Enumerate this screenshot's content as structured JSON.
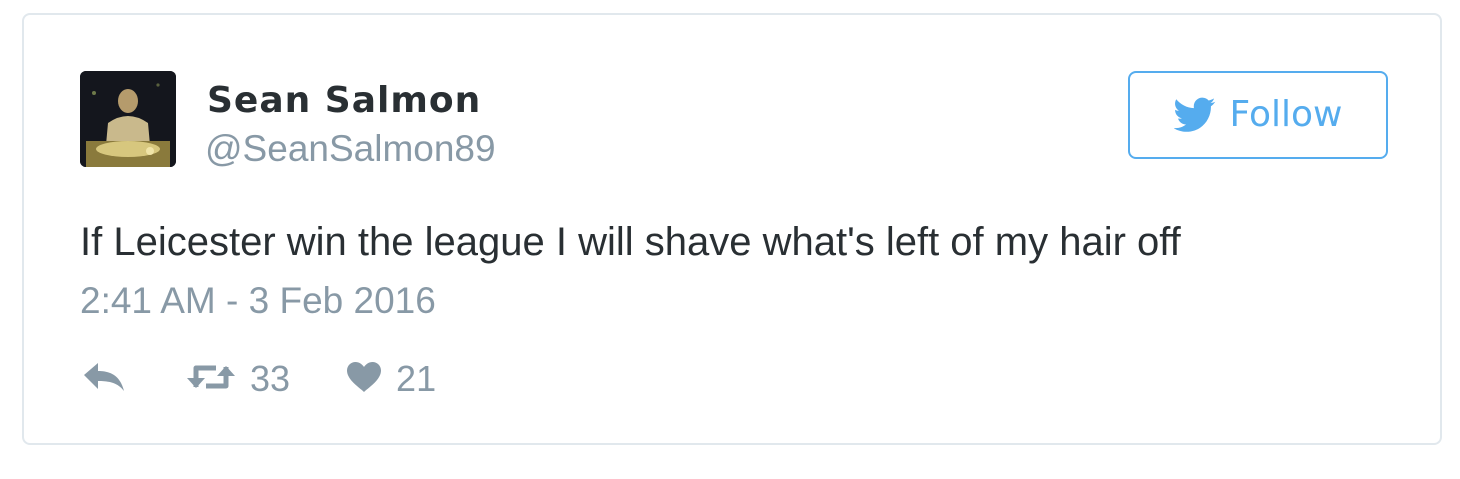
{
  "author": {
    "name": "Sean Salmon",
    "handle": "@SeanSalmon89",
    "avatar": "avatar-photo"
  },
  "follow_button": {
    "label": "Follow",
    "icon": "twitter-bird-icon"
  },
  "tweet": {
    "text": "If Leicester win the league I will shave what's left of my hair off",
    "timestamp": "2:41 AM - 3 Feb 2016"
  },
  "actions": {
    "reply": {
      "icon": "reply-icon"
    },
    "retweet": {
      "icon": "retweet-icon",
      "count": "33"
    },
    "like": {
      "icon": "heart-icon",
      "count": "21"
    }
  },
  "colors": {
    "accent": "#55acee",
    "text": "#292f33",
    "muted": "#8899a6",
    "border": "#e1e8ed"
  }
}
